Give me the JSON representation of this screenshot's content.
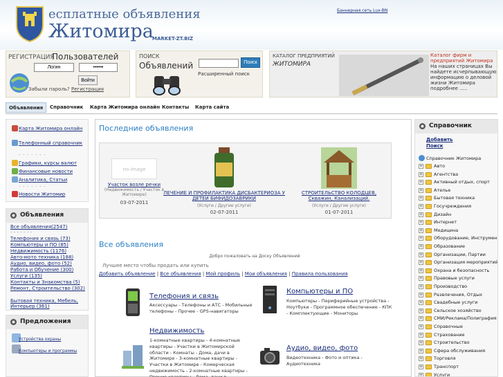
{
  "header": {
    "title_line1": "есплатные объявления",
    "title_line2": "Житомира",
    "domain": "MARKET-ZT.BIZ",
    "lux_link": "Баннерная сеть Lux-BN"
  },
  "registration": {
    "title_small": "РЕГИСТРАЦИЯ",
    "title_big": "Пользователей",
    "login_value": "Логин",
    "password_value": "••••••",
    "enter_button": "Войти",
    "forgot": "Забыли пароль?",
    "register_link": "Регистрация"
  },
  "search": {
    "title_small": "ПОИСК",
    "title_big": "Объявлений",
    "button": "Поиск",
    "advanced": "Расширенный поиск"
  },
  "catalog": {
    "title_small": "КАТАЛОГ ПРЕДПРИЯТИЙ",
    "title_big": "ЖИТОМИРА",
    "desc_highlight": "Каталог фирм и предприятий Житомира",
    "desc_rest": "На наших страницах Вы найдете исчерпывающую информацию о деловой жизни Житомира подробнее ....."
  },
  "nav": {
    "tabs": [
      "Объявления",
      "Справочник",
      "Карта Житомира онлайн",
      "Контакты",
      "Карта сайта"
    ]
  },
  "left_links": {
    "items": [
      "Карта Житомира онлайн",
      "Телефонный справочник",
      "Графики, курсы валют",
      "Финансовые новости",
      "Аналитика, Статьи",
      "Новости Житомир"
    ],
    "dashes": "- - - - - - -"
  },
  "left_ads": {
    "title": "Объявления",
    "categories": [
      "Все объявления(2547)",
      "- - - - - - -",
      "Телефония и связь (73)",
      "Компьютеры и ПО (85)",
      "Недвижимость (1176)",
      "Авто-мото техника (188)",
      "Аудио, видео, фото (52)",
      "Работа и Обучение (300)",
      "Услуги (135)",
      "Контакты и Знакомства (5)",
      "Ремонт, Строительство (302)",
      "Бытовая техника, Мебель, Интерьер (361)"
    ]
  },
  "left_pred": {
    "title": "Предложения",
    "items": [
      "Устройства охраны",
      "Компьютеры и программы"
    ]
  },
  "center": {
    "latest_title": "Последние объявления",
    "latest": [
      {
        "no_image": "no image",
        "title": "Участок возле речки",
        "category": "(Недвижимость / Участок в Житомире)",
        "date": "03-07-2011"
      },
      {
        "title": "ЛЕЧЕНИЕ И ПРОФИЛАКТИКА ДИСБАКТЕРИОЗА У ДЕТЕЙ БИФИДОЗАВРИКИ",
        "category": "(Услуги / Другие услуги)",
        "date": "02-07-2011"
      },
      {
        "title": "СТРОИТЕЛЬСТВО КОЛОДЦЕВ, Скважин, Канализаций.",
        "category": "(Услуги / Другие услуги)",
        "date": "01-07-2011"
      }
    ],
    "all_title": "Все объявления",
    "welcome": "Добро пожаловать на Доску Объявлений",
    "best_place": "Лучшее место чтобы продать или купить",
    "links": [
      "Добавить объявление",
      "Все объявления",
      "Мой профиль",
      "Мои объявления",
      "Правила пользования"
    ],
    "sep": "|",
    "categories": [
      {
        "name": "Телефония и связь",
        "sub": "Аксессуары - Телефоны и АТС - Мобильные телефоны - Прочее - GPS-навигаторы"
      },
      {
        "name": "Компьютеры и ПО",
        "sub": "Компьютеры - Периферийные устройства - Ноутбуки - Программное обеспечение - КПК - Комплектующие - Мониторы"
      },
      {
        "name": "Недвижимость",
        "sub": "1-комнатные квартиры - 4-комнатные квартиры - Участки в Житомирской области - Комнаты - Дома, дачи в Житомире - 3-комнатные квартиры - Участки в Житомире - Комерческая недвижимость - 2-комнатные квартиры - Прочие квартиры - Дома, дачи в"
      },
      {
        "name": "Аудио, видео, фото",
        "sub": "Видеотехника - Фото и оптика - Аудиотехника"
      }
    ]
  },
  "right": {
    "title": "Справочник",
    "add": "Добавить",
    "search": "Поиск",
    "root": "Справочник Житомира",
    "items": [
      "Авто",
      "Агентства",
      "Активный отдых, спорт",
      "Ателье",
      "Бытовая техника",
      "Госучреждения",
      "Дизайн",
      "Интернет",
      "Медицина",
      "Оборудование, Инструменты",
      "Образование",
      "Организации, Партии",
      "Организация мероприятий",
      "Охрана и безопасность",
      "Правовые услуги",
      "Производство",
      "Развлечения, Отдых",
      "Свадебные услуги",
      "Сельское хозяйство",
      "СМИ/Реклама/Полиграфия",
      "Справочные",
      "Страхование",
      "Строительство",
      "Сфера обслуживания",
      "Торговля",
      "Транспорт",
      "Услуги"
    ]
  },
  "colors": {
    "accent_blue": "#2c7fc4",
    "link": "#1a2e7a",
    "search_button": "#2e7db8"
  }
}
